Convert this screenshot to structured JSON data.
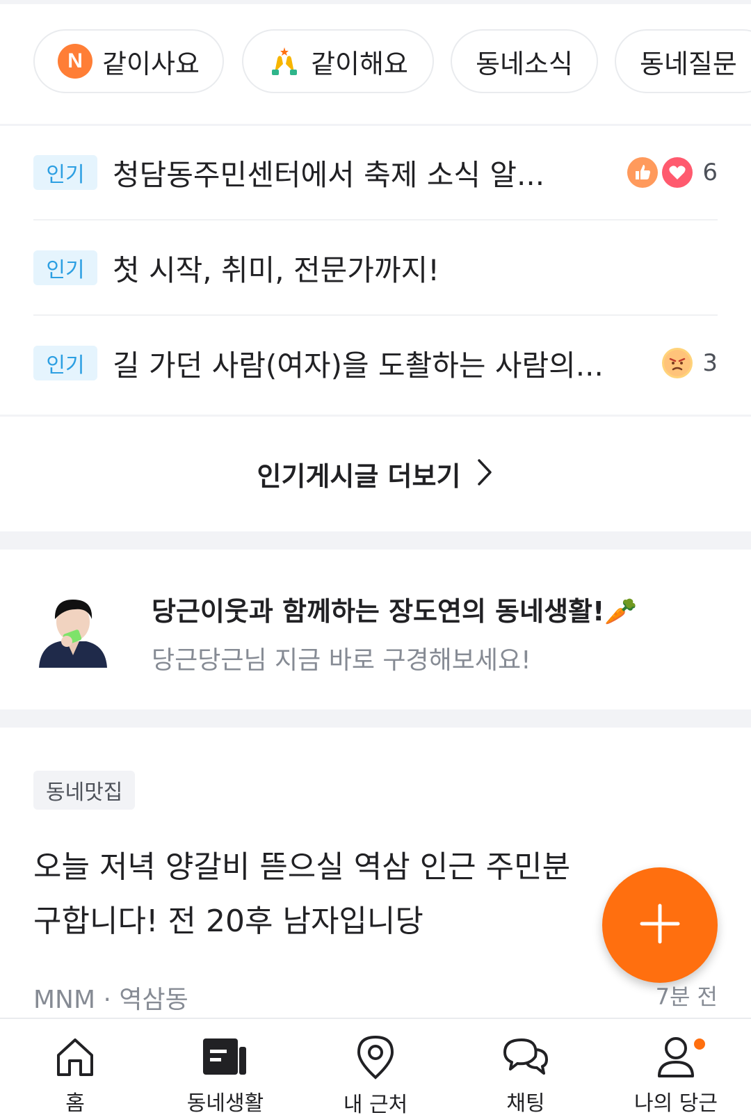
{
  "chips": [
    {
      "label": "같이사요",
      "icon": "naver-n-icon"
    },
    {
      "label": "같이해요",
      "icon": "raised-hands-icon"
    },
    {
      "label": "동네소식",
      "icon": ""
    },
    {
      "label": "동네질문",
      "icon": ""
    }
  ],
  "popular": {
    "posts": [
      {
        "badge": "인기",
        "title": "청담동주민센터에서 축제 소식 알...",
        "reactions": [
          "thumbs-up-icon",
          "heart-icon"
        ],
        "count": "6"
      },
      {
        "badge": "인기",
        "title": "첫 시작, 취미, 전문가까지!",
        "reactions": [],
        "count": ""
      },
      {
        "badge": "인기",
        "title": "길 가던 사람(여자)을 도촬하는 사람의...",
        "reactions": [
          "angry-face-icon"
        ],
        "count": "3"
      }
    ],
    "more_label": "인기게시글 더보기"
  },
  "banner": {
    "title": "당근이웃과 함께하는 장도연의 동네생활!🥕",
    "subtitle": "당근당근님 지금 바로 구경해보세요!"
  },
  "feed": {
    "category": "동네맛집",
    "title": "오늘 저녁 양갈비 뜯으실 역삼 인근 주민분 구합니다! 전 20후 남자입니당",
    "author": "MNM",
    "location": "역삼동",
    "meta_sep": " · ",
    "time": "7분 전"
  },
  "nav": [
    {
      "label": "홈",
      "icon": "home-icon"
    },
    {
      "label": "동네생활",
      "icon": "news-icon"
    },
    {
      "label": "내 근처",
      "icon": "location-pin-icon"
    },
    {
      "label": "채팅",
      "icon": "chat-bubbles-icon"
    },
    {
      "label": "나의 당근",
      "icon": "person-icon"
    }
  ],
  "colors": {
    "accent": "#ff6f0f",
    "badge_bg": "#e5f4fd",
    "badge_text": "#2c9fe2",
    "muted_text": "#868b94"
  }
}
